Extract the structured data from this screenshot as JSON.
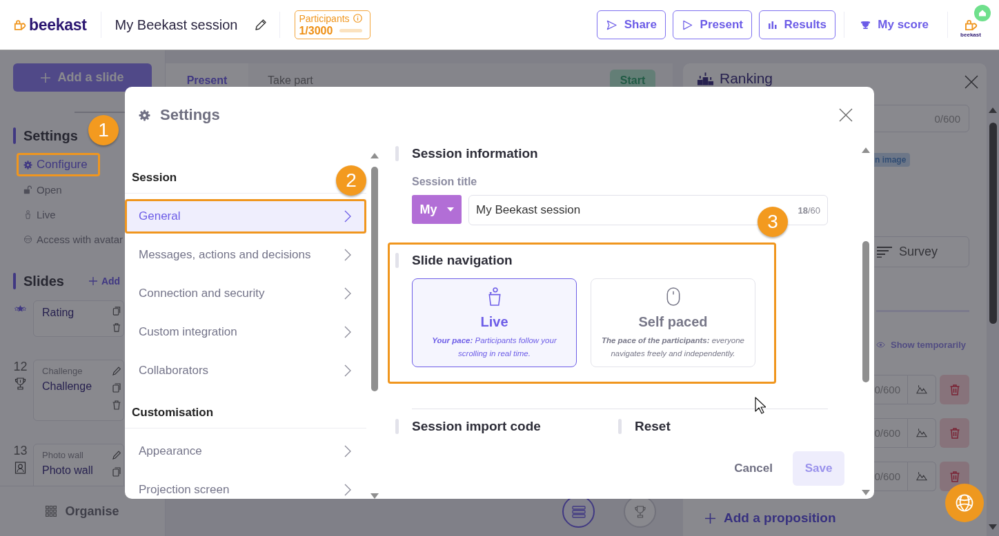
{
  "header": {
    "logo": "beekast",
    "session_title": "My Beekast session",
    "participants": {
      "label": "Participants",
      "count": "1/3000",
      "level": 0.0003
    },
    "actions": [
      {
        "kind": "share",
        "label": "Share"
      },
      {
        "kind": "present",
        "label": "Present"
      },
      {
        "kind": "results",
        "label": "Results"
      }
    ],
    "score": "My score",
    "avatar_label": "beekast"
  },
  "sidebar": {
    "add_slide": "Add a slide",
    "settings_heading": "Settings",
    "settings_items": [
      {
        "kind": "configure",
        "label": "Configure",
        "selected": true,
        "callout": "1"
      },
      {
        "kind": "open",
        "label": "Open",
        "selected": false
      },
      {
        "kind": "live",
        "label": "Live",
        "selected": false
      },
      {
        "kind": "avatar",
        "label": "Access with avatar",
        "selected": false
      }
    ],
    "slides_heading": "Slides",
    "add_link": "Add",
    "slides": [
      {
        "kind": "rating",
        "title": "Rating"
      },
      {
        "kind": "challenge",
        "number": "12",
        "category": "Challenge",
        "title": "Challenge"
      },
      {
        "kind": "photo",
        "number": "13",
        "category": "Photo wall",
        "title": "Photo wall"
      }
    ],
    "organise": "Organise"
  },
  "editor": {
    "tabs": [
      {
        "label": "Present",
        "selected": true
      },
      {
        "label": "Take part",
        "selected": false
      }
    ],
    "start": "Start",
    "views": [
      {
        "kind": "list",
        "selected": true
      },
      {
        "kind": "trophy",
        "selected": false
      }
    ]
  },
  "question_panel": {
    "title": "Ranking",
    "counter": "0/600",
    "tag": "n image",
    "survey": "Survey",
    "show_temporarily": "Show temporarily",
    "propositions": [
      {
        "counter": "0/600"
      },
      {
        "counter": "0/600"
      },
      {
        "counter": "0/600"
      }
    ],
    "add_proposition": "Add a proposition"
  },
  "settings_dialog": {
    "title": "Settings",
    "nav": [
      {
        "heading": "Session",
        "items": [
          {
            "label": "General",
            "selected": true,
            "callout": "2"
          },
          {
            "label": "Messages, actions and decisions",
            "selected": false
          },
          {
            "label": "Connection and security",
            "selected": false
          },
          {
            "label": "Custom integration",
            "selected": false
          },
          {
            "label": "Collaborators",
            "selected": false
          }
        ]
      },
      {
        "heading": "Customisation",
        "items": [
          {
            "label": "Appearance",
            "selected": false
          },
          {
            "label": "Projection screen",
            "selected": false
          }
        ]
      }
    ],
    "session_information": {
      "title": "Session information",
      "field_label": "Session title",
      "prefix": "My",
      "value": "My Beekast session",
      "counter": "**18**/60"
    },
    "slide_navigation": {
      "title": "Slide navigation",
      "callout": "3",
      "options": [
        {
          "kind": "live",
          "label": "Live",
          "description": "**Your pace:** Participants follow your scrolling in real time.",
          "selected": true
        },
        {
          "kind": "self_paced",
          "label": "Self paced",
          "description": "**The pace of the participants:** everyone navigates freely and independently.",
          "selected": false
        }
      ]
    },
    "more_sections": [
      "Session import code",
      "Reset"
    ],
    "cancel": "Cancel",
    "save": {
      "label": "Save",
      "disabled": true
    }
  }
}
